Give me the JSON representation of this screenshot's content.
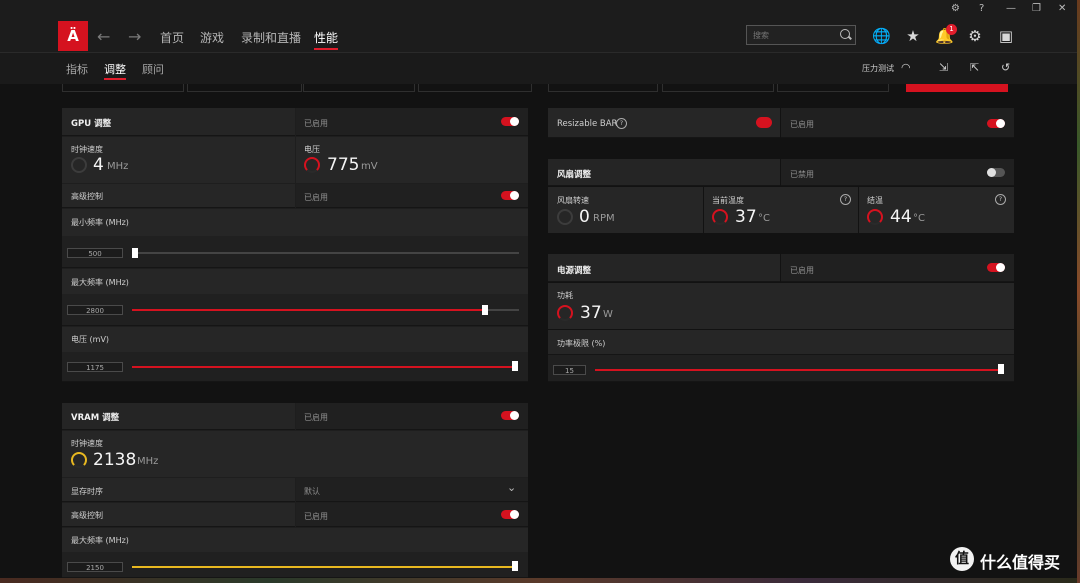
{
  "window": {
    "controls": [
      "⚙",
      "?",
      "—",
      "❐",
      "✕"
    ]
  },
  "nav": {
    "logo_text": "Ä",
    "back": "←",
    "forward": "→",
    "tabs": [
      {
        "label": "首页"
      },
      {
        "label": "游戏"
      },
      {
        "label": "录制和直播"
      },
      {
        "label": "性能"
      }
    ],
    "search_placeholder": "搜索",
    "icons": [
      "globe-icon",
      "star-icon",
      "bell-icon",
      "gear-icon",
      "layout-icon"
    ],
    "notification_count": "1"
  },
  "subnav": {
    "tabs": [
      {
        "label": "指标"
      },
      {
        "label": "调整"
      },
      {
        "label": "顾问"
      }
    ],
    "stress_test": "压力测试",
    "icons": [
      "gauge-icon",
      "import-icon",
      "export-icon",
      "reset-icon"
    ]
  },
  "gpu": {
    "title": "GPU 调整",
    "status": "已启用",
    "enabled": true,
    "clock_label": "时钟速度",
    "clock_value": "4",
    "clock_unit": "MHz",
    "voltage_label": "电压",
    "voltage_value": "775",
    "voltage_unit": "mV",
    "advanced_label": "高级控制",
    "advanced_status": "已启用",
    "min_freq_label": "最小频率 (MHz)",
    "min_freq_value": "500",
    "min_freq_fraction": 0.0,
    "max_freq_label": "最大频率 (MHz)",
    "max_freq_value": "2800",
    "max_freq_fraction": 0.91,
    "volt_label": "电压 (mV)",
    "volt_value": "1175",
    "volt_fraction": 1.0
  },
  "vram": {
    "title": "VRAM 调整",
    "status": "已启用",
    "clock_label": "时钟速度",
    "clock_value": "2138",
    "clock_unit": "MHz",
    "timing_label": "显存时序",
    "timing_value": "默认",
    "advanced_label": "高级控制",
    "advanced_status": "已启用",
    "max_freq_label": "最大频率 (MHz)",
    "max_freq_value": "2150",
    "max_freq_fraction": 1.0
  },
  "rebar": {
    "label": "Resizable BAR",
    "status": "已启用"
  },
  "fan": {
    "title": "风扇调整",
    "status": "已禁用",
    "speed_label": "风扇转速",
    "speed_value": "0",
    "speed_unit": "RPM",
    "temp_label": "当前温度",
    "temp_value": "37",
    "temp_unit": "°C",
    "junction_label": "结温",
    "junction_value": "44",
    "junction_unit": "°C"
  },
  "power": {
    "title": "电源调整",
    "status": "已启用",
    "draw_label": "功耗",
    "draw_value": "37",
    "draw_unit": "W",
    "limit_label": "功率极限 (%)",
    "limit_value": "15",
    "limit_fraction": 1.0
  },
  "watermark": {
    "text": "什么值得买",
    "logo": "值"
  },
  "colors": {
    "accent": "#d5121f",
    "vram_accent": "#e8b820"
  }
}
